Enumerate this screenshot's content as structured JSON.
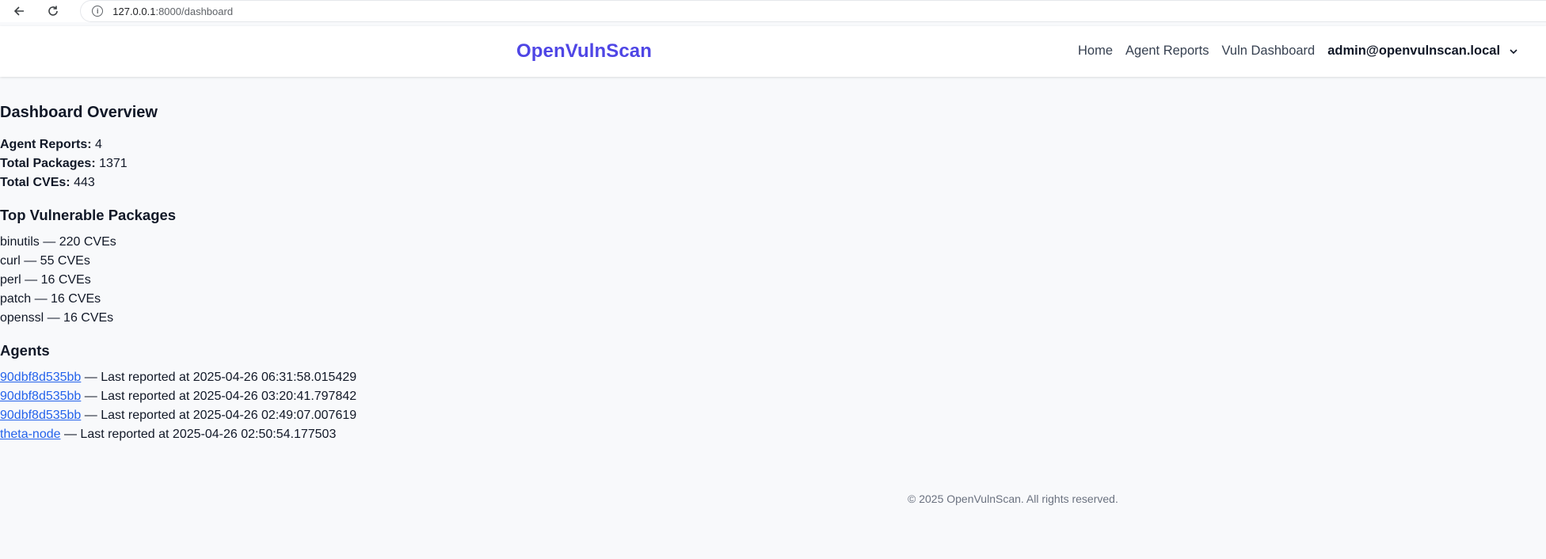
{
  "browser": {
    "url_host": "127.0.0.1",
    "url_rest": ":8000/dashboard"
  },
  "header": {
    "brand": "OpenVulnScan",
    "nav": {
      "home": "Home",
      "agent_reports": "Agent Reports",
      "vuln_dashboard": "Vuln Dashboard"
    },
    "user": "admin@openvulnscan.local"
  },
  "overview": {
    "title": "Dashboard Overview",
    "stats": [
      {
        "label": "Agent Reports:",
        "value": "4"
      },
      {
        "label": "Total Packages:",
        "value": "1371"
      },
      {
        "label": "Total CVEs:",
        "value": "443"
      }
    ]
  },
  "top_packages": {
    "title": "Top Vulnerable Packages",
    "items": [
      "binutils — 220 CVEs",
      "curl — 55 CVEs",
      "perl — 16 CVEs",
      "patch — 16 CVEs",
      "openssl — 16 CVEs"
    ]
  },
  "agents": {
    "title": "Agents",
    "items": [
      {
        "name": "90dbf8d535bb",
        "text": " — Last reported at 2025-04-26 06:31:58.015429"
      },
      {
        "name": "90dbf8d535bb",
        "text": " — Last reported at 2025-04-26 03:20:41.797842"
      },
      {
        "name": "90dbf8d535bb",
        "text": " — Last reported at 2025-04-26 02:49:07.007619"
      },
      {
        "name": "theta-node",
        "text": " — Last reported at 2025-04-26 02:50:54.177503"
      }
    ]
  },
  "footer": {
    "text": "© 2025 OpenVulnScan. All rights reserved."
  },
  "colors": {
    "brand": "#4f46e5",
    "link": "#2563eb",
    "background": "#f8f9fb"
  }
}
